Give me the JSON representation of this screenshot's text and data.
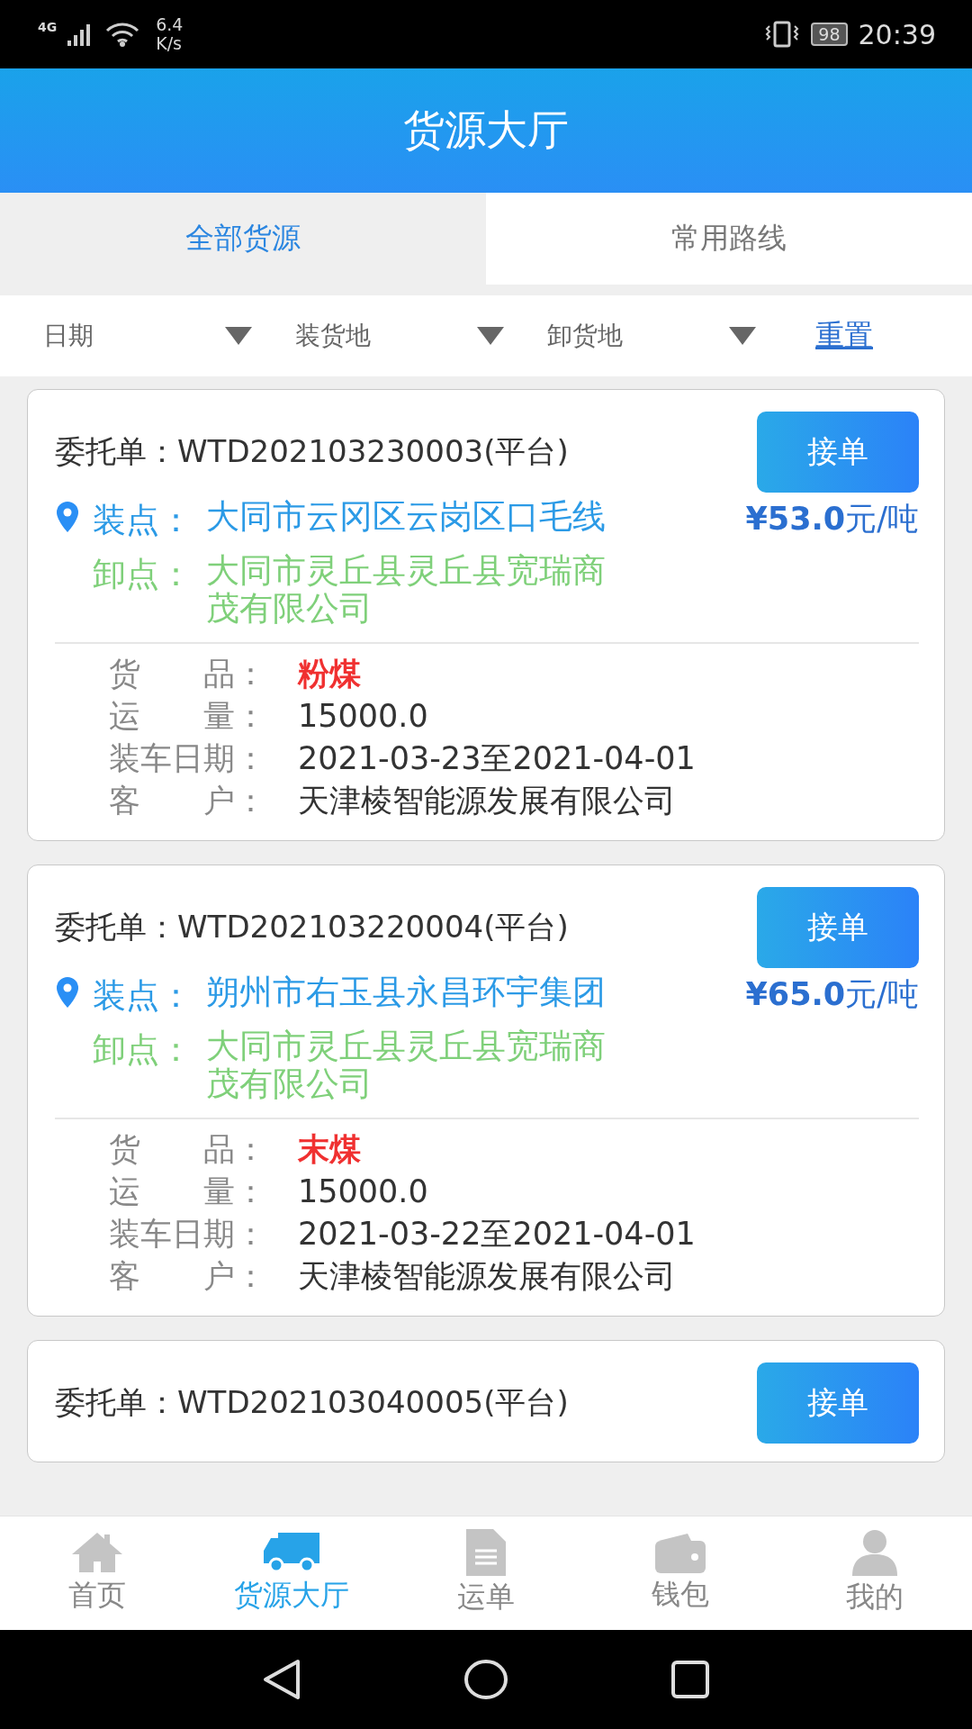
{
  "status_bar": {
    "network": "4G",
    "speed_value": "6.4",
    "speed_unit": "K/s",
    "battery": "98",
    "time": "20:39"
  },
  "header": {
    "title": "货源大厅"
  },
  "tabs": [
    {
      "label": "全部货源",
      "selected": true
    },
    {
      "label": "常用路线",
      "selected": false
    }
  ],
  "filters": [
    {
      "label": "日期"
    },
    {
      "label": "装货地"
    },
    {
      "label": "卸货地"
    }
  ],
  "reset": "重置",
  "orders": [
    {
      "label": "委托单：",
      "number": "WTD202103230003(平台)",
      "button": "接单",
      "load_label": "装点：",
      "load": "大同市云冈区云岗区口毛线",
      "price": "**¥53.0**元/吨",
      "unload_label": "卸点：",
      "unload": "大同市灵丘县灵丘县宽瑞商茂有限公司",
      "details": [
        {
          "label": "货　　品：",
          "value": "粉煤",
          "kind": "highlight"
        },
        {
          "label": "运　　量：",
          "value": "15000.0",
          "kind": "plain"
        },
        {
          "label": "装车日期：",
          "value": "2021-03-23至2021-04-01",
          "kind": "plain"
        },
        {
          "label": "客　　户：",
          "value": "天津棱智能源发展有限公司",
          "kind": "plain"
        }
      ]
    },
    {
      "label": "委托单：",
      "number": "WTD202103220004(平台)",
      "button": "接单",
      "load_label": "装点：",
      "load": "朔州市右玉县永昌环宇集团",
      "price": "**¥65.0**元/吨",
      "unload_label": "卸点：",
      "unload": "大同市灵丘县灵丘县宽瑞商茂有限公司",
      "details": [
        {
          "label": "货　　品：",
          "value": "末煤",
          "kind": "highlight"
        },
        {
          "label": "运　　量：",
          "value": "15000.0",
          "kind": "plain"
        },
        {
          "label": "装车日期：",
          "value": "2021-03-22至2021-04-01",
          "kind": "plain"
        },
        {
          "label": "客　　户：",
          "value": "天津棱智能源发展有限公司",
          "kind": "plain"
        }
      ]
    },
    {
      "label": "委托单：",
      "number": "WTD202103040005(平台)",
      "button": "接单"
    }
  ],
  "nav": [
    {
      "label": "首页",
      "kind": "home",
      "selected": false
    },
    {
      "label": "货源大厅",
      "kind": "cargo",
      "selected": true
    },
    {
      "label": "运单",
      "kind": "waybill",
      "selected": false
    },
    {
      "label": "钱包",
      "kind": "wallet",
      "selected": false
    },
    {
      "label": "我的",
      "kind": "profile",
      "selected": false
    }
  ]
}
